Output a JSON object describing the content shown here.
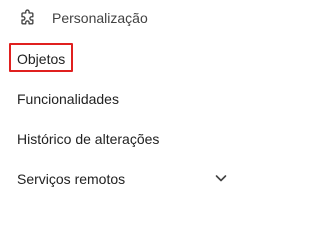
{
  "menu": {
    "items": [
      {
        "label": "Personalização",
        "icon": "puzzle-piece-icon"
      },
      {
        "label": "Objetos",
        "highlighted": true
      },
      {
        "label": "Funcionalidades"
      },
      {
        "label": "Histórico de alterações"
      },
      {
        "label": "Serviços remotos",
        "icon": "chevron-down-icon"
      }
    ]
  },
  "colors": {
    "highlight": "#e0201f",
    "text": "#212121",
    "icon": "#424242"
  }
}
